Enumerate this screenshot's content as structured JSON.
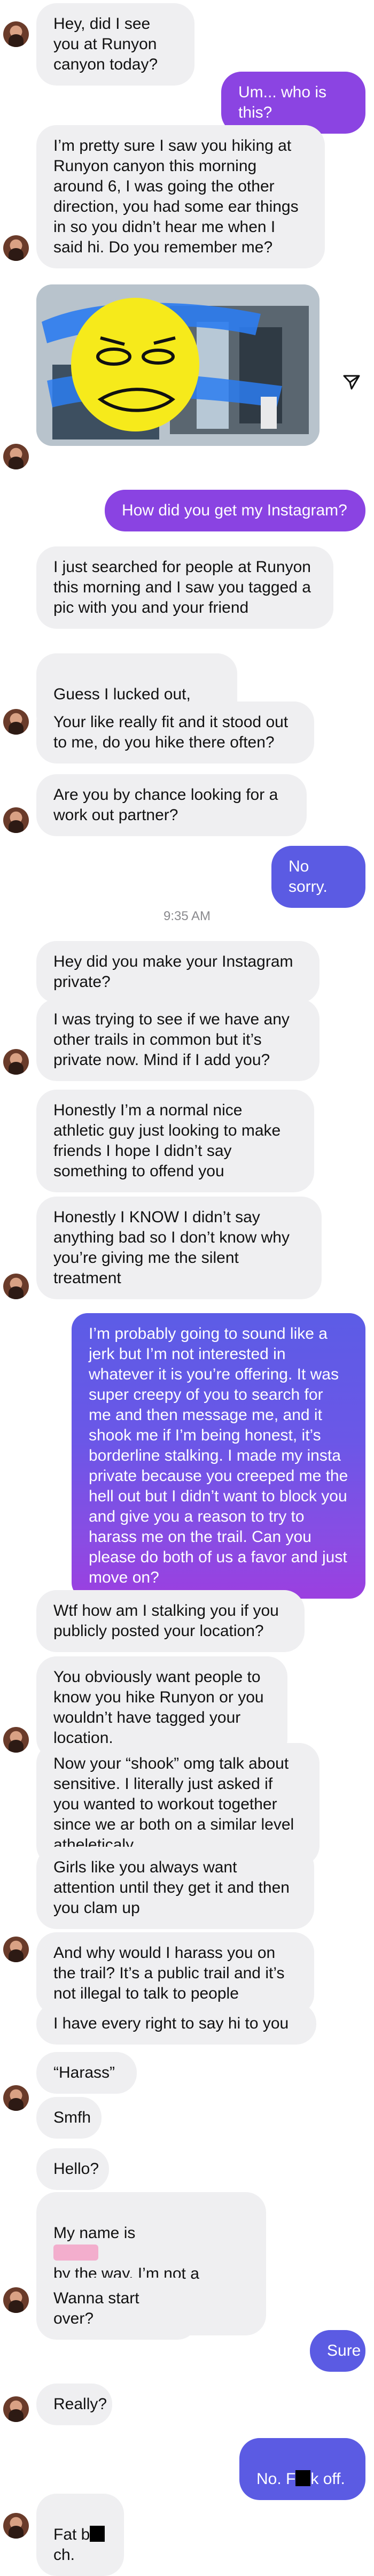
{
  "colors": {
    "incoming_bg": "#efeff1",
    "outgoing_blue": "#5b5be3",
    "outgoing_purple": "#9b3fe0",
    "timestamp": "#8a8a8e"
  },
  "timestamp_1": "9:35 AM",
  "messages": [
    {
      "text": "Hey, did I see you at Runyon canyon today?"
    },
    {
      "text": "Um... who is this?"
    },
    {
      "text": "I’m pretty sure I saw you hiking at Runyon canyon this morning around 6, I was going the other direction, you had some ear things in so you didn’t hear me when I said hi. Do you remember me?"
    },
    {
      "text": "How did you get my Instagram?"
    },
    {
      "text": "I just searched for people at Runyon this morning and I saw you tagged a pic with you and your friend"
    },
    {
      "text": "Guess I lucked out,"
    },
    {
      "text": "Your like really fit and it stood out to me, do you hike there often?"
    },
    {
      "text": "Are you by chance looking for a work out partner?"
    },
    {
      "text": "No sorry."
    },
    {
      "text": "Hey did you make your Instagram private?"
    },
    {
      "text": "I was trying to see if we have any other trails in common but it’s private now. Mind if I add you?"
    },
    {
      "text": "Honestly I’m a normal nice athletic guy just looking to make friends I hope I didn’t say something to offend you"
    },
    {
      "text": "Honestly I KNOW I didn’t say anything bad so I don’t know why you’re giving me the silent treatment"
    },
    {
      "text": "I’m probably going to sound like a jerk but I’m not interested in whatever it is you’re offering. It was super creepy of you to search for me and then message me, and it shook me if I’m being honest, it’s borderline stalking. I made my insta private because you creeped me the hell out but I didn’t want to block you and give you a reason to try to harass me on the trail. Can you please do both of us a favor and just move on?"
    },
    {
      "text": "Wtf how am I stalking you if you publicly posted your location?"
    },
    {
      "text": "You obviously want people to know you hike Runyon or you wouldn’t have tagged your location."
    },
    {
      "text": "Now your “shook” omg talk about sensitive. I literally just asked if you wanted to workout together since we ar both on a similar level atheleticaly"
    },
    {
      "text": "Girls like you always want attention until they get it and then you clam up"
    },
    {
      "text": "And why would I harass you on the trail? It’s a public trail and it’s not illegal to talk to people"
    },
    {
      "text": "I have every right to say hi to you"
    },
    {
      "text": "“Harass”"
    },
    {
      "text": "Smfh"
    },
    {
      "text": "Hello?"
    },
    {
      "text_before": "My name is",
      "text_after": "by the way, I’m not a stalker"
    },
    {
      "text": "Wanna start over?"
    },
    {
      "text": "Sure"
    },
    {
      "text": "Really?"
    },
    {
      "text_before": "No. F",
      "text_after": "k off."
    },
    {
      "text_before": "Fat b",
      "text_after": "ch."
    }
  ],
  "icons": {
    "share": "paper-plane-icon",
    "avatar": "profile-avatar"
  }
}
